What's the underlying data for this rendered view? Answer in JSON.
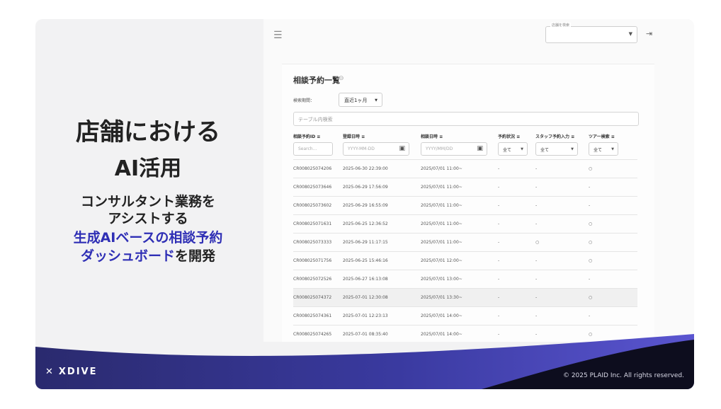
{
  "slide": {
    "title_line1": "店舗における",
    "title_line2": "AI活用",
    "subtitle_line1": "コンサルタント業務を",
    "subtitle_line2": "アシストする",
    "subtitle_line3": "生成AIベースの相談予約",
    "subtitle_line4_blue": "ダッシュボード",
    "subtitle_line4_rest": "を開発",
    "brand": "XDIVE",
    "copyright": "© 2025 PLAID Inc. All rights reserved.",
    "accent_color": "#2f2fb5"
  },
  "header": {
    "menu_icon": "☰",
    "store_label": "店舗を検索",
    "logout_icon": "logout-icon"
  },
  "page": {
    "title": "相談予約一覧",
    "period_label": "検索期間：",
    "period_value": "直近1ヶ月",
    "search_placeholder": "テーブル内検索"
  },
  "columns": [
    "相談予約ID",
    "登録日時",
    "相談日時",
    "予約状況",
    "スタッフ予約入力",
    "ツアー検索"
  ],
  "filters": {
    "id_placeholder": "Search...",
    "registered_placeholder": "YYYY-MM-DD",
    "consult_placeholder": "YYYY/MM/DD",
    "status_value": "全て",
    "staff_value": "全て",
    "tour_value": "全て"
  },
  "rows": [
    {
      "id": "CR008025074206",
      "registered": "2025-06-30 22:39:00",
      "consult": "2025/07/01 11:00~",
      "status": "-",
      "staff": "-",
      "tour": "○"
    },
    {
      "id": "CR008025073646",
      "registered": "2025-06-29 17:56:09",
      "consult": "2025/07/01 11:00~",
      "status": "-",
      "staff": "-",
      "tour": "-"
    },
    {
      "id": "CR008025073602",
      "registered": "2025-06-29 16:55:09",
      "consult": "2025/07/01 11:00~",
      "status": "-",
      "staff": "-",
      "tour": "-"
    },
    {
      "id": "CR008025071631",
      "registered": "2025-06-25 12:36:52",
      "consult": "2025/07/01 11:00~",
      "status": "-",
      "staff": "-",
      "tour": "○"
    },
    {
      "id": "CR008025073333",
      "registered": "2025-06-29 11:17:15",
      "consult": "2025/07/01 11:00~",
      "status": "-",
      "staff": "○",
      "tour": "○"
    },
    {
      "id": "CR008025071756",
      "registered": "2025-06-25 15:46:16",
      "consult": "2025/07/01 12:00~",
      "status": "-",
      "staff": "-",
      "tour": "○"
    },
    {
      "id": "CR008025072526",
      "registered": "2025-06-27 16:13:08",
      "consult": "2025/07/01 13:00~",
      "status": "-",
      "staff": "-",
      "tour": "-"
    },
    {
      "id": "CR008025074372",
      "registered": "2025-07-01 12:30:08",
      "consult": "2025/07/01 13:30~",
      "status": "-",
      "staff": "-",
      "tour": "○"
    },
    {
      "id": "CR008025074361",
      "registered": "2025-07-01 12:23:13",
      "consult": "2025/07/01 14:00~",
      "status": "-",
      "staff": "-",
      "tour": "-"
    },
    {
      "id": "CR008025074265",
      "registered": "2025-07-01 08:35:40",
      "consult": "2025/07/01 14:00~",
      "status": "-",
      "staff": "-",
      "tour": "○"
    }
  ]
}
